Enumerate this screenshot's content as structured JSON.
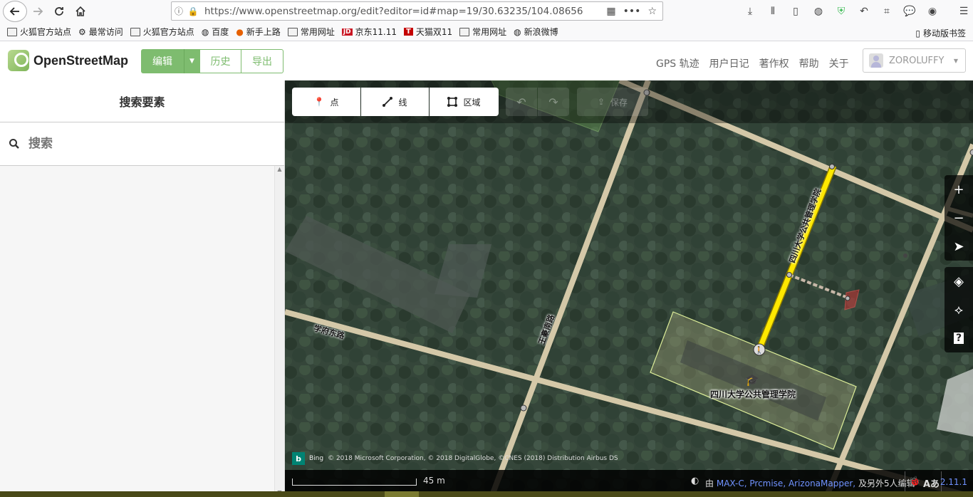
{
  "browser": {
    "url": "https://www.openstreetmap.org/edit?editor=id#map=19/30.63235/104.08656",
    "bookmarks": [
      {
        "label": "火狐官方站点",
        "icon": "folder-icon"
      },
      {
        "label": "最常访问",
        "icon": "gear-icon"
      },
      {
        "label": "火狐官方站点",
        "icon": "folder-icon"
      },
      {
        "label": "百度",
        "icon": "globe-icon"
      },
      {
        "label": "新手上路",
        "icon": "firefox-icon"
      },
      {
        "label": "常用网址",
        "icon": "folder-icon"
      },
      {
        "label": "京东11.11",
        "icon": "jd-icon"
      },
      {
        "label": "天猫双11",
        "icon": "tmall-icon"
      },
      {
        "label": "常用网址",
        "icon": "folder-icon"
      },
      {
        "label": "新浪微博",
        "icon": "globe-icon"
      }
    ],
    "mobile_bookmarks": "移动版书签"
  },
  "header": {
    "logo_text": "OpenStreetMap",
    "edit_label": "编辑",
    "history_label": "历史",
    "export_label": "导出",
    "links": [
      "GPS 轨迹",
      "用户日记",
      "著作权",
      "帮助",
      "关于"
    ],
    "username": "ZOROLUFFY"
  },
  "sidebar": {
    "title": "搜索要素",
    "search_placeholder": "搜索"
  },
  "map": {
    "tools": {
      "point": "点",
      "line": "线",
      "area": "区域",
      "save": "保存"
    },
    "labels": {
      "road_xuefu": "学府东路",
      "road_wangbian": "王豪南路",
      "path_school": "四川大学公共管理学院",
      "building": "四川大学公共管理学院"
    },
    "attribution": "© 2018 Microsoft Corporation, © 2018 DigitalGlobe, ©CNES (2018) Distribution Airbus DS",
    "bing_label": "Bing",
    "scale_label": "45 m",
    "contributors_prefix": "由",
    "contributors_links": "MAX-C, Prcmise, ArizonaMapper,",
    "contributors_suffix": "及另外5人编辑",
    "version": "2.11.1",
    "colors": {
      "accent": "#7ebc6f",
      "road": "#d4c8a8",
      "footway": "#ffe800",
      "link": "#7092ff"
    }
  }
}
